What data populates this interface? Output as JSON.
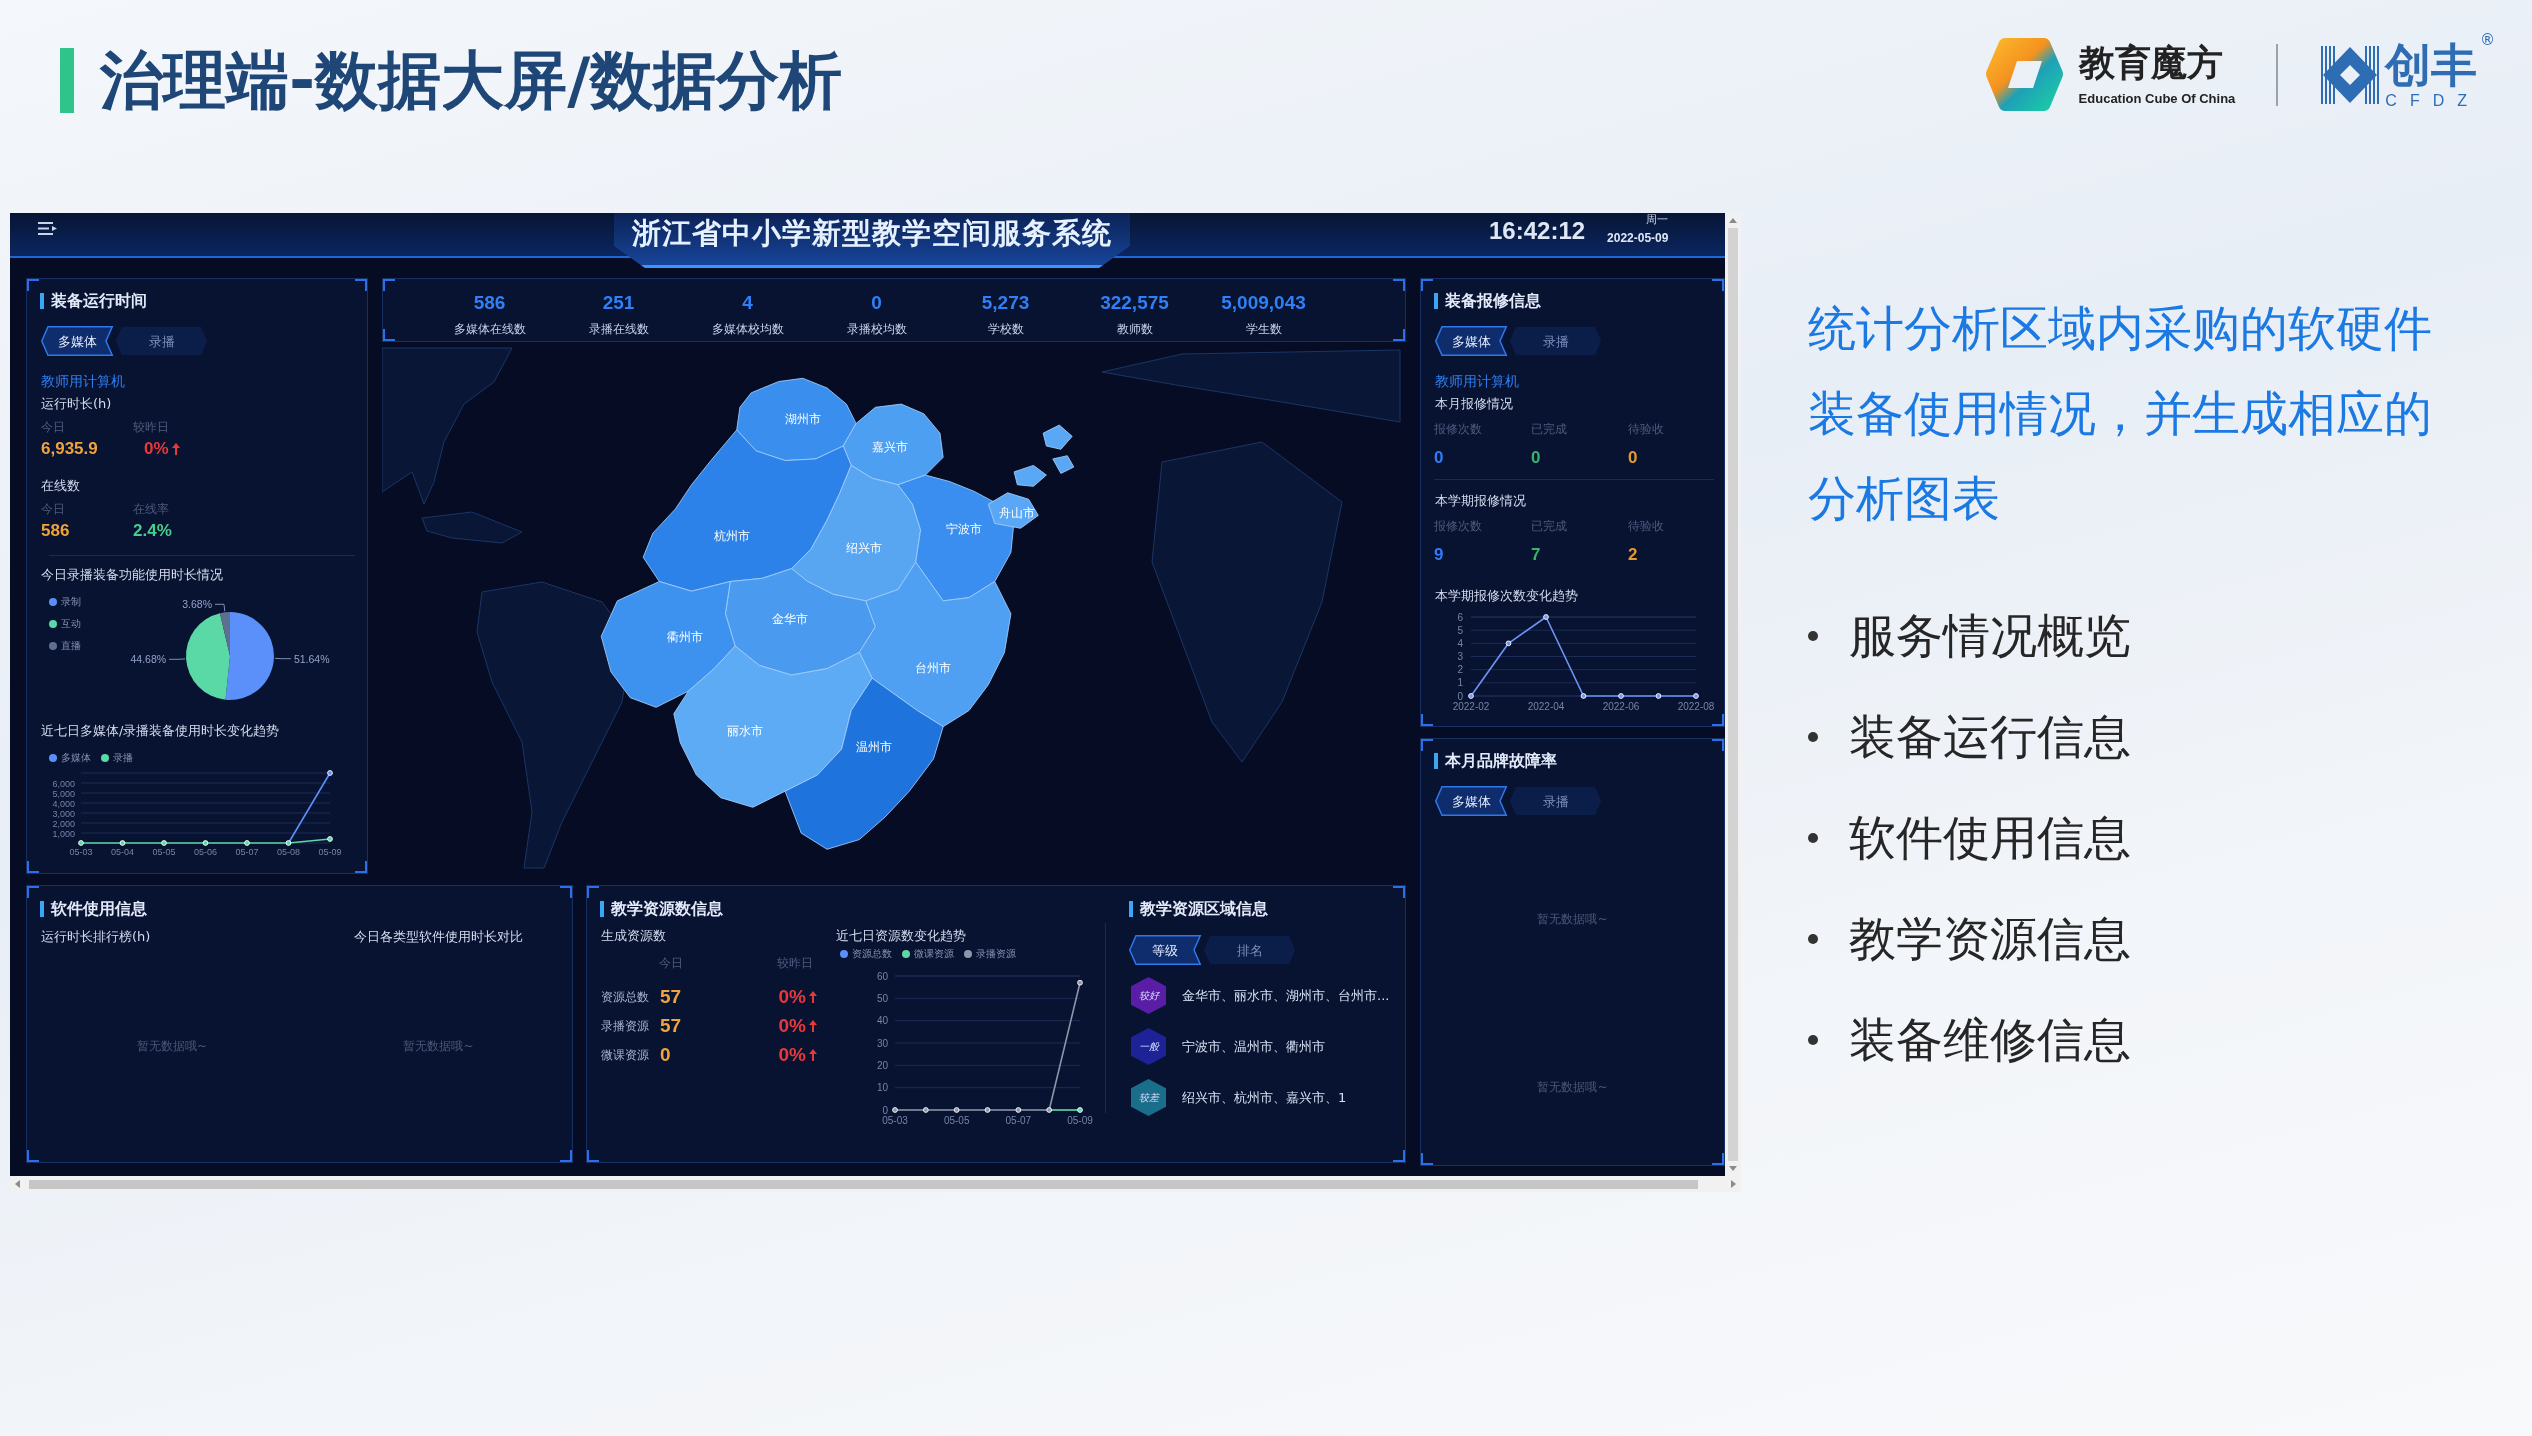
{
  "slide": {
    "title": "治理端-数据大屏/数据分析"
  },
  "logos": [
    {
      "name": "教育魔方",
      "tagline": "Education Cube Of China"
    },
    {
      "name": "创丰",
      "tagline": "CFDZ",
      "mark": "®"
    }
  ],
  "dashboard": {
    "header": {
      "title": "浙江省中小学新型教学空间服务系统",
      "time": "16:42:12",
      "weekday": "周一",
      "date": "2022-05-09"
    },
    "runtime_panel": {
      "title": "装备运行时间",
      "tabs": [
        {
          "label": "多媒体",
          "selected": true
        },
        {
          "label": "录播",
          "selected": false
        }
      ],
      "device": "教师用计算机",
      "runtime": {
        "title": "运行时长(h)",
        "today_label": "今日",
        "today": "6,935.9",
        "change_label": "较昨日",
        "change": "0%",
        "increase": true
      },
      "online": {
        "title": "在线数",
        "today_label": "今日",
        "today": "586",
        "rate_label": "在线率",
        "rate": "2.4%"
      },
      "usage": {
        "title": "今日录播装备功能使用时长情况",
        "chart_data": {
          "type": "pie",
          "categories": [
            "录制",
            "互动",
            "直播"
          ],
          "values": [
            51.64,
            44.68,
            3.68
          ],
          "value_labels": [
            "51.64%",
            "44.68%",
            "3.68%"
          ],
          "legend": "left"
        }
      },
      "trend": {
        "title": "近七日多媒体/录播装备使用时长变化趋势",
        "chart_data": {
          "type": "line",
          "x": [
            "05-03",
            "05-04",
            "05-05",
            "05-06",
            "05-07",
            "05-08",
            "05-09"
          ],
          "series": [
            {
              "name": "多媒体",
              "color": "#5b8ff9",
              "marker": true,
              "values": [
                null,
                null,
                null,
                null,
                null,
                0,
                7000
              ]
            },
            {
              "name": "录播",
              "color": "#5ad8a6",
              "marker": true,
              "values": [
                0,
                0,
                0,
                0,
                0,
                0,
                400
              ]
            }
          ],
          "ylim": [
            0,
            7000
          ],
          "yticks": [
            {
              "value": 1000,
              "label": "1,000"
            },
            {
              "value": 2000,
              "label": "2,000"
            },
            {
              "value": 3000,
              "label": "3,000"
            },
            {
              "value": 4000,
              "label": "4,000"
            },
            {
              "value": 5000,
              "label": "5,000"
            },
            {
              "value": 6000,
              "label": "6,000"
            }
          ],
          "grid": true,
          "legend": "top"
        }
      }
    },
    "stats": [
      {
        "value": "586",
        "label": "多媒体在线数"
      },
      {
        "value": "251",
        "label": "录播在线数"
      },
      {
        "value": "4",
        "label": "多媒体校均数"
      },
      {
        "value": "0",
        "label": "录播校均数"
      },
      {
        "value": "5,273",
        "label": "学校数"
      },
      {
        "value": "322,575",
        "label": "教师数"
      },
      {
        "value": "5,009,043",
        "label": "学生数"
      }
    ],
    "map": {
      "regions": [
        {
          "name": "湖州市",
          "color": "#3a8fee"
        },
        {
          "name": "嘉兴市",
          "color": "#4d9ff2"
        },
        {
          "name": "杭州市",
          "color": "#2c82e8"
        },
        {
          "name": "绍兴市",
          "color": "#58a6f2"
        },
        {
          "name": "宁波市",
          "color": "#3a8ef0"
        },
        {
          "name": "舟山市",
          "color": "#5aa8f5"
        },
        {
          "name": "金华市",
          "color": "#4a9bf0"
        },
        {
          "name": "衢州市",
          "color": "#3d92ef"
        },
        {
          "name": "台州市",
          "color": "#4f9ff2"
        },
        {
          "name": "丽水市",
          "color": "#5eabf5"
        },
        {
          "name": "温州市",
          "color": "#1e74dc"
        }
      ]
    },
    "software_panel": {
      "title": "软件使用信息",
      "sections": [
        {
          "title": "运行时长排行榜(h)",
          "empty_message": "暂无数据哦~"
        },
        {
          "title": "今日各类型软件使用时长对比",
          "empty_message": "暂无数据哦~"
        }
      ]
    },
    "resource_panel": {
      "title": "教学资源数信息",
      "subtitle": "生成资源数",
      "columns": [
        "今日",
        "较昨日"
      ],
      "rows": [
        {
          "label": "资源总数",
          "today": "57",
          "change": "0%",
          "increase": true
        },
        {
          "label": "录播资源",
          "today": "57",
          "change": "0%",
          "increase": true
        },
        {
          "label": "微课资源",
          "today": "0",
          "change": "0%",
          "increase": true
        }
      ],
      "trend": {
        "title": "近七日资源数变化趋势",
        "chart_data": {
          "type": "line",
          "x": [
            "05-03",
            null,
            "05-05",
            null,
            "05-07",
            null,
            "05-09"
          ],
          "series": [
            {
              "name": "资源总数",
              "color": "#5b8ff9",
              "marker": true,
              "values": [
                null,
                null,
                null,
                null,
                null,
                null,
                null
              ]
            },
            {
              "name": "微课资源",
              "color": "#5ad8a6",
              "marker": true,
              "values": [
                null,
                null,
                null,
                null,
                null,
                0,
                0
              ]
            },
            {
              "name": "录播资源",
              "color": "#8d95a8",
              "marker": true,
              "values": [
                0,
                0,
                0,
                0,
                0,
                0,
                57
              ]
            }
          ],
          "ylim": [
            0,
            60
          ],
          "yticks": [
            0,
            10,
            20,
            30,
            40,
            50,
            60
          ],
          "grid": true,
          "legend": "top"
        }
      }
    },
    "region_panel": {
      "title": "教学资源区域信息",
      "tabs": [
        {
          "label": "等级",
          "selected": true
        },
        {
          "label": "排名",
          "selected": false
        }
      ],
      "levels": [
        {
          "badge": "较好",
          "color": "#5a1ea6",
          "cities": "金华市、丽水市、湖州市、台州市..."
        },
        {
          "badge": "一般",
          "color": "#1d2296",
          "cities": "宁波市、温州市、衢州市"
        },
        {
          "badge": "较差",
          "color": "#1b6e8a",
          "cities": "绍兴市、杭州市、嘉兴市、1"
        }
      ]
    },
    "repair_panel": {
      "title": "装备报修信息",
      "tabs": [
        {
          "label": "多媒体",
          "selected": true
        },
        {
          "label": "录播",
          "selected": false
        }
      ],
      "device": "教师用计算机",
      "sections": [
        {
          "title": "本月报修情况",
          "metrics": [
            {
              "label": "报修次数",
              "value": "0",
              "color": "#2f7cf6"
            },
            {
              "label": "已完成",
              "value": "0",
              "color": "#35b56a"
            },
            {
              "label": "待验收",
              "value": "0",
              "color": "#e39a2d"
            }
          ]
        },
        {
          "title": "本学期报修情况",
          "metrics": [
            {
              "label": "报修次数",
              "value": "9",
              "color": "#2f7cf6"
            },
            {
              "label": "已完成",
              "value": "7",
              "color": "#35b56a"
            },
            {
              "label": "待验收",
              "value": "2",
              "color": "#e39a2d"
            }
          ]
        }
      ],
      "trend": {
        "title": "本学期报修次数变化趋势",
        "chart_data": {
          "type": "line",
          "x": [
            "2022-02",
            null,
            "2022-04",
            null,
            "2022-06",
            null,
            "2022-08"
          ],
          "series": [
            {
              "color": "#6f95f5",
              "marker": true,
              "values": [
                0,
                4,
                6,
                0,
                0,
                0,
                0
              ]
            }
          ],
          "ylim": [
            0,
            6
          ],
          "yticks": [
            0,
            1,
            2,
            3,
            4,
            5,
            6
          ],
          "grid": true
        }
      }
    },
    "fault_panel": {
      "title": "本月品牌故障率",
      "tabs": [
        {
          "label": "多媒体",
          "selected": true
        },
        {
          "label": "录播",
          "selected": false
        }
      ],
      "empty_messages": [
        "暂无数据哦~",
        "暂无数据哦~"
      ]
    }
  },
  "description": "统计分析区域内采购的软硬件装备使用情况，并生成相应的分析图表",
  "bullets": [
    "服务情况概览",
    "装备运行信息",
    "软件使用信息",
    "教学资源信息",
    "装备维修信息"
  ]
}
